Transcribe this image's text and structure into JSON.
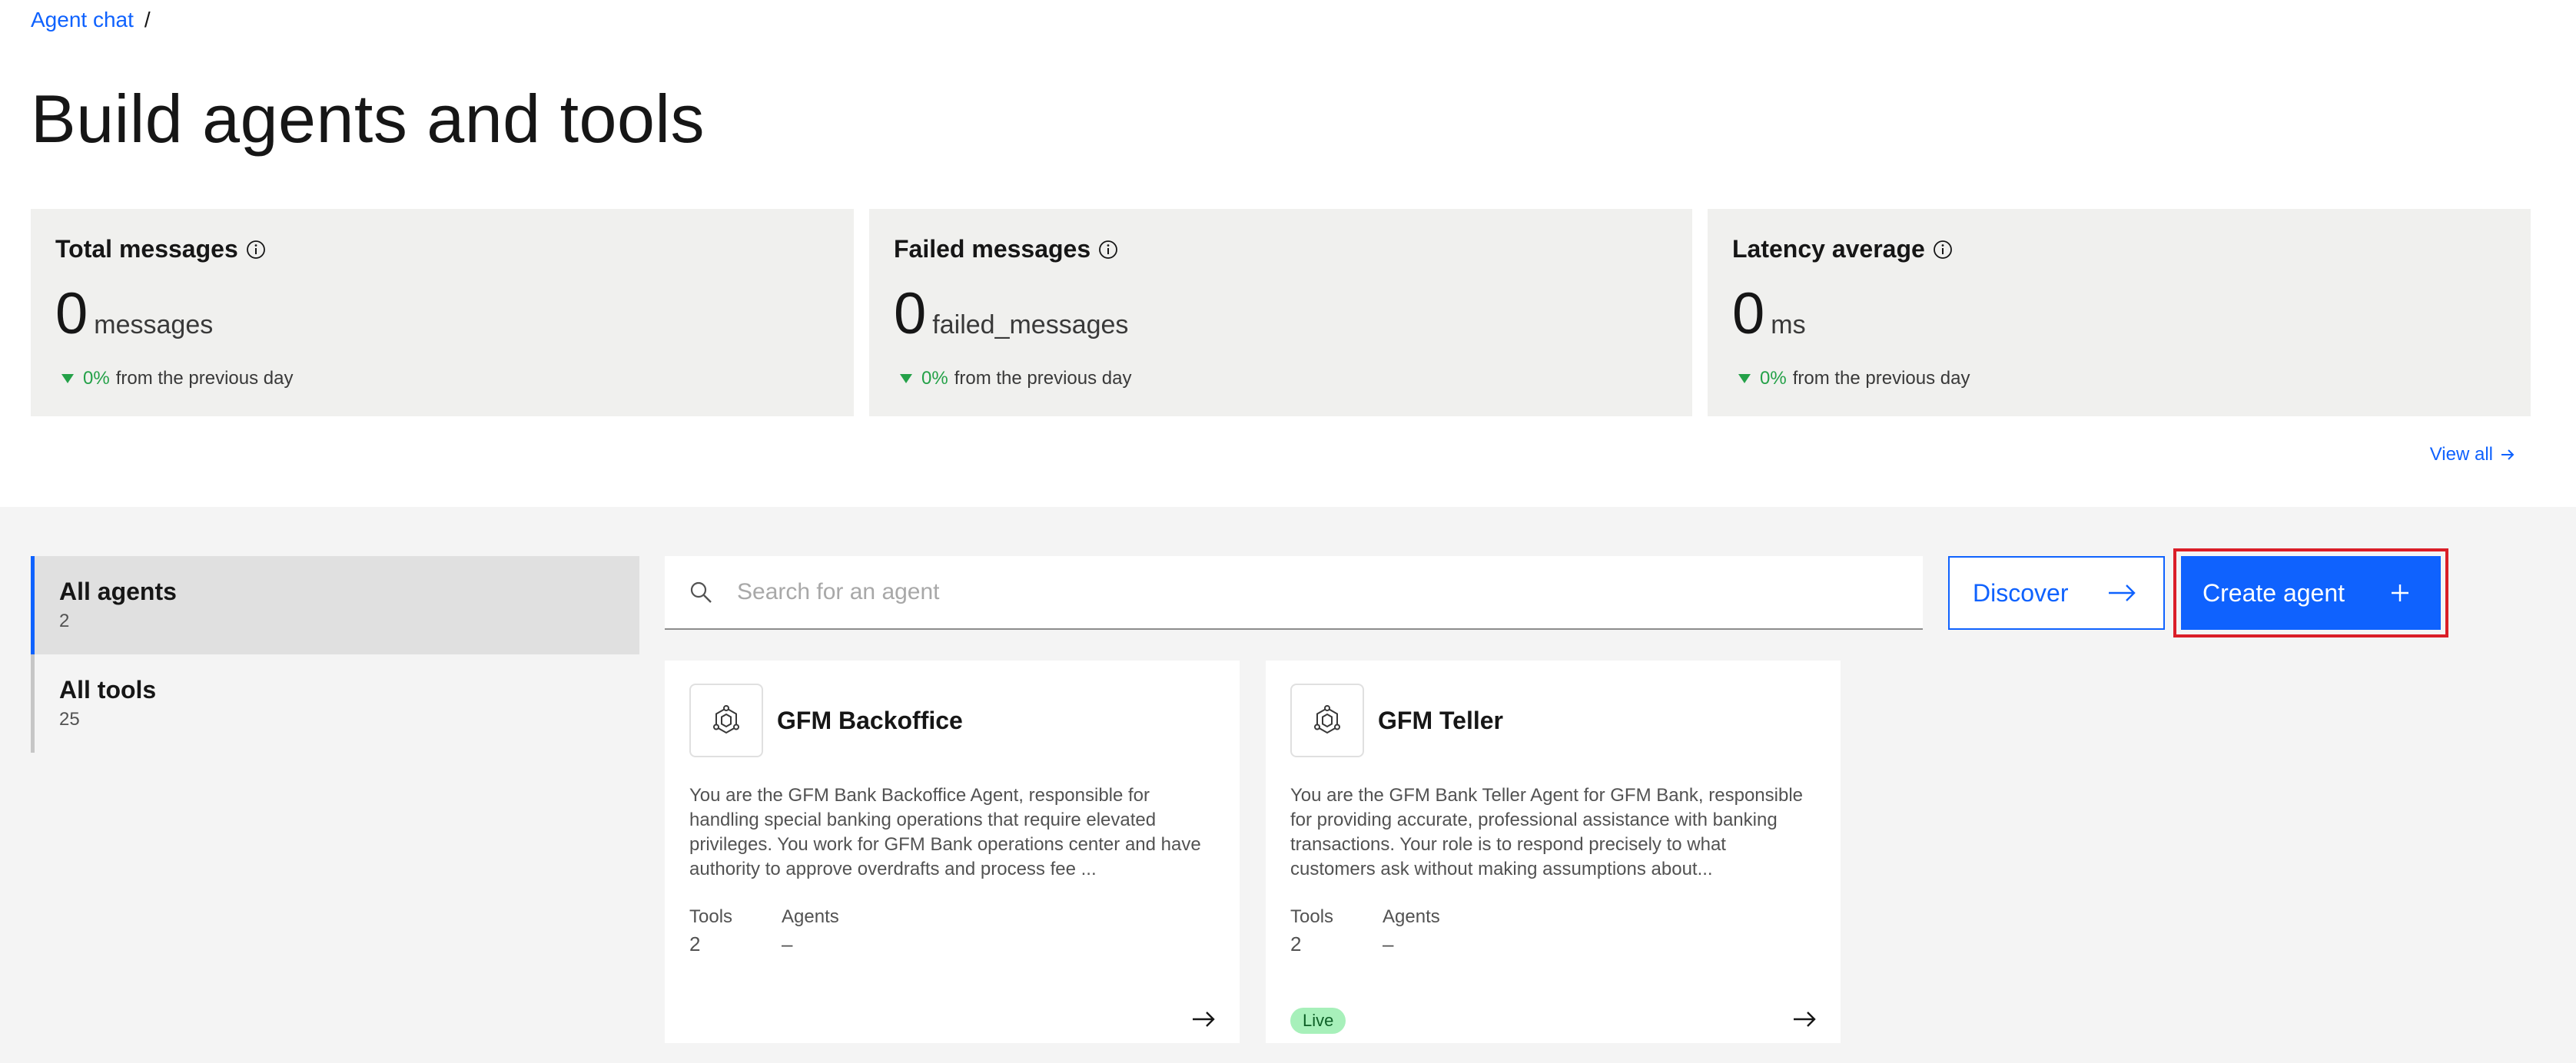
{
  "breadcrumb": {
    "link": "Agent chat",
    "separator": "/"
  },
  "page_title": "Build agents and tools",
  "metrics": [
    {
      "title": "Total messages",
      "value": "0",
      "unit": "messages",
      "delta_pct": "0%",
      "delta_text": "from the previous day"
    },
    {
      "title": "Failed messages",
      "value": "0",
      "unit": "failed_messages",
      "delta_pct": "0%",
      "delta_text": "from the previous day"
    },
    {
      "title": "Latency average",
      "value": "0",
      "unit": "ms",
      "delta_pct": "0%",
      "delta_text": "from the previous day"
    }
  ],
  "view_all": "View all",
  "side_nav": [
    {
      "label": "All agents",
      "count": "2"
    },
    {
      "label": "All tools",
      "count": "25"
    }
  ],
  "search": {
    "placeholder": "Search for an agent",
    "value": ""
  },
  "discover_label": "Discover",
  "create_label": "Create agent",
  "agents": [
    {
      "name": "GFM Backoffice",
      "description": "You are the GFM Bank Backoffice Agent, responsible for handling special banking operations that require elevated privileges. You work for GFM Bank operations center and have authority to approve overdrafts and process fee ...",
      "tools_label": "Tools",
      "tools_value": "2",
      "agents_label": "Agents",
      "agents_value": "–"
    },
    {
      "name": "GFM Teller",
      "description": "You are the GFM Bank Teller Agent for GFM Bank, responsible for providing accurate, professional assistance with banking transactions. Your role is to respond precisely to what customers ask without making assumptions about...",
      "tools_label": "Tools",
      "tools_value": "2",
      "agents_label": "Agents",
      "agents_value": "–",
      "status": "Live"
    }
  ],
  "colors": {
    "accent": "#0f62fe",
    "positive": "#24a148",
    "highlight_border": "#da1e28",
    "live_tag": "#a7f0ba"
  },
  "icons": [
    "info-icon",
    "caret-down-icon",
    "arrow-right-icon",
    "search-icon",
    "plus-icon",
    "agent-icon"
  ]
}
